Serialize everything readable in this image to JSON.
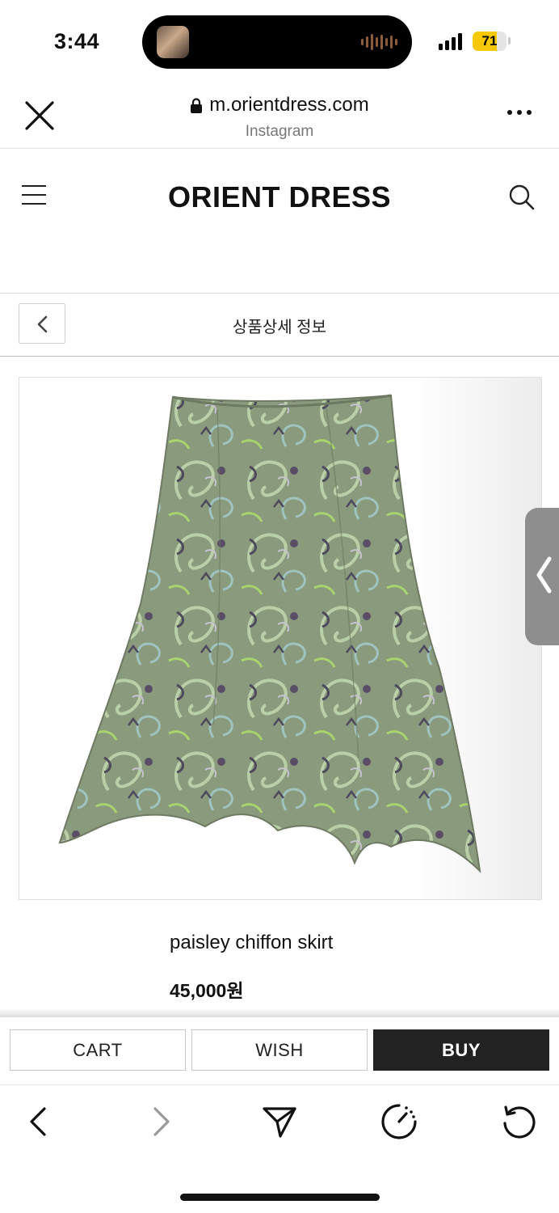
{
  "status_bar": {
    "time": "3:44",
    "battery": "71",
    "battery_level": 0.71
  },
  "browser": {
    "url": "m.orientdress.com",
    "source": "Instagram",
    "close_icon": "close-icon",
    "lock_icon": "lock-icon",
    "more_icon": "more-icon"
  },
  "site": {
    "logo": "ORIENT DRESS",
    "menu_icon": "hamburger-menu-icon",
    "search_icon": "search-icon"
  },
  "title_bar": {
    "title": "상품상세 정보",
    "back_icon": "chevron-left-icon"
  },
  "product": {
    "name": "paisley chiffon skirt",
    "price": "45,000원",
    "image_icon": "paisley-skirt-photo"
  },
  "actions": {
    "cart": "CART",
    "wish": "WISH",
    "buy": "BUY"
  },
  "nav": {
    "items": [
      "back-icon",
      "forward-icon",
      "share-icon",
      "speed-icon",
      "reload-icon"
    ]
  },
  "colors": {
    "buy_button": "#222222",
    "battery_fill": "#f5c800",
    "skirt_base": "#8a9a7c"
  }
}
